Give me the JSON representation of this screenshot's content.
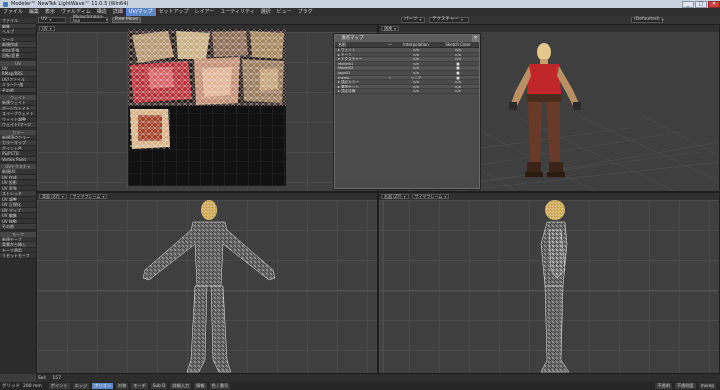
{
  "window": {
    "title": "Modeler™ NewTek LightWave™ 11.0.3 (Win64)",
    "buttons": [
      "_",
      "□",
      "✕"
    ]
  },
  "menubar": {
    "items": [
      "ファイル",
      "編集",
      "表示",
      "ヴァルディム",
      "構造",
      "詳細",
      "UV/マップ",
      "セットアップ",
      "レイアー",
      "ユーティリティ",
      "選択",
      "ビュー",
      "プラグ"
    ],
    "active_index": 6
  },
  "toolbar": {
    "uv_select": "UV",
    "morph_select": "Mxrechmann-tex",
    "free_move": "Free Move",
    "parts_select": "パーツ",
    "texture_select": "テクスチャー",
    "layout_select": "(Defaulted)"
  },
  "sidebar": {
    "groups": [
      {
        "items": [
          "ファイル",
          "編集",
          "ヘルプ"
        ]
      },
      {
        "items": [
          "ツール",
          "新規作成",
          "追加/変換",
          "回転/変更"
        ]
      },
      {
        "header": "UV",
        "items": [
          "UV",
          "RMap/RRS",
          "UV/ファイル",
          "ミラー/一般",
          "その他"
        ]
      },
      {
        "header": "ウェイト",
        "items": [
          "新規ウェイト",
          "ボーンウェイト",
          "スイープウェイト",
          "ウェイト調整",
          "ウェイト/マージ"
        ]
      },
      {
        "header": "カラー",
        "items": [
          "新規頂点カラー",
          "カラーマップ",
          "ポイント色",
          "PS/PCTB",
          "Vertex Paint"
        ]
      },
      {
        "header": "UVテクスチャ",
        "items": [
          "新規UV",
          "UV 作成",
          "UV 投影",
          "UV 変換",
          "ストレッチ",
          "UV 調整",
          "UV 正規化",
          "UV マップ",
          "UV 編集",
          "UV 移動",
          "その他"
        ]
      },
      {
        "header": "モーフ",
        "items": [
          "新規モーフ",
          "背景から挿入",
          "モーフ適用",
          "リセットモーフ"
        ]
      }
    ]
  },
  "viewports": {
    "uv": {
      "view_label": "UV"
    },
    "perspective": {
      "view_label": "透視"
    },
    "front": {
      "view_label": "背面 (XY)",
      "shade_label": "ワイヤフレーム"
    },
    "side": {
      "view_label": "右面 (ZY)",
      "shade_label": "ワイヤフレーム"
    }
  },
  "vertex_map_panel": {
    "title": "頂点マップ",
    "columns": [
      "名前",
      "—",
      "Interpolation",
      "Sketch Color"
    ],
    "rows": [
      {
        "name": "▸ ウェイト",
        "check": "",
        "interp": "n/a",
        "sketch": "n/a"
      },
      {
        "name": "▸ モーフ",
        "check": "",
        "interp": "n/a",
        "sketch": "n/a"
      },
      {
        "name": "▾ テクスチャー",
        "check": "",
        "interp": "n/a",
        "sketch": "n/a"
      },
      {
        "name": "   Model01",
        "check": "",
        "interp": "n/a",
        "sketch": "■"
      },
      {
        "name": "   Model02",
        "check": "",
        "interp": "n/a",
        "sketch": "■"
      },
      {
        "name": "   Jaga01",
        "check": "",
        "interp": "n/a",
        "sketch": "■"
      },
      {
        "name": "   mxrep",
        "check": "✓",
        "interp": "リニア",
        "sketch": "■"
      },
      {
        "name": "▸ 頂点カラー",
        "check": "",
        "interp": "n/a",
        "sketch": "n/a"
      },
      {
        "name": "▸ 選択セット",
        "check": "",
        "interp": "n/a",
        "sketch": "n/a"
      },
      {
        "name": "▸ 頂点法線",
        "check": "",
        "interp": "n/a",
        "sketch": "n/a"
      }
    ]
  },
  "status": {
    "sel_label": "Sel:",
    "sel_value": "157",
    "grid_label": "グリッド",
    "grid_value": "200 mm"
  },
  "bottom_bar": {
    "items": [
      "ポイント",
      "エッジ",
      "ポリゴン",
      "対称",
      "モーデ",
      "Sub D",
      "詳細入力",
      "情報",
      "色 / 番号"
    ],
    "active_index": 2,
    "right_items": [
      "不透明",
      "不透明度",
      "mxrep"
    ]
  },
  "colors": {
    "accent": "#5b87c4",
    "skin": "#e4c78a",
    "shirt": "#c0262a",
    "pants": "#6a3a28",
    "wire": "#e8e8e8"
  }
}
